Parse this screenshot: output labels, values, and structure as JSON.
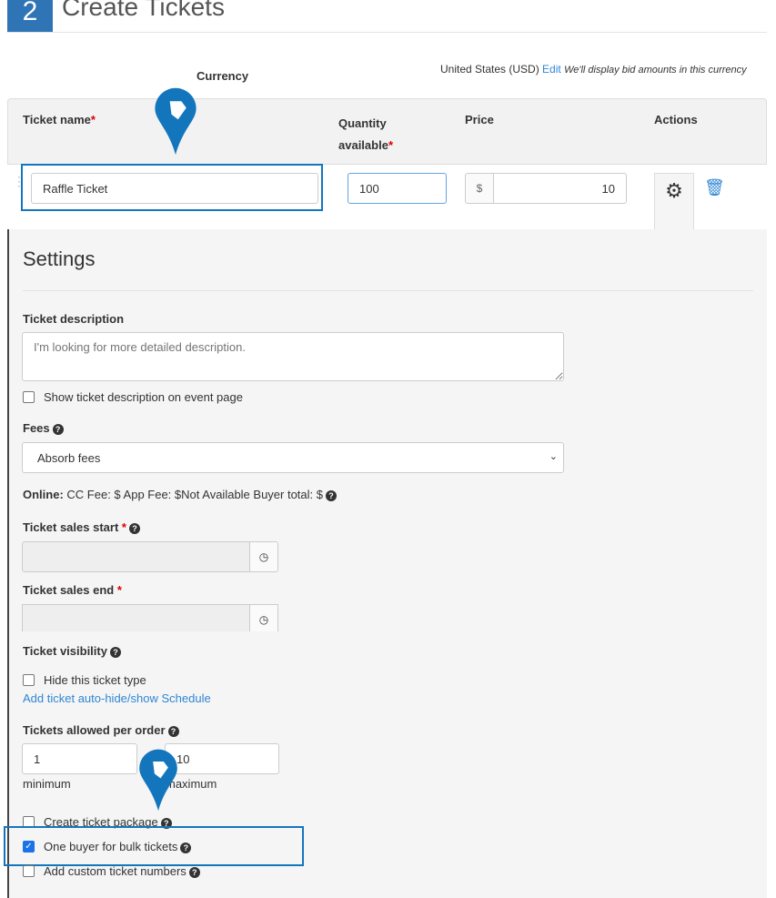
{
  "header": {
    "step": "2",
    "title": "Create Tickets"
  },
  "currency": {
    "label": "Currency",
    "value": "United States (USD)",
    "edit": "Edit",
    "note": "We'll display bid amounts in this currency"
  },
  "table": {
    "columns": {
      "name": "Ticket name",
      "quantity": "Quantity available",
      "price": "Price",
      "actions": "Actions"
    },
    "required_mark": "*",
    "row": {
      "name": "Raffle Ticket",
      "quantity": "100",
      "currency_symbol": "$",
      "price": "10"
    }
  },
  "settings": {
    "title": "Settings",
    "description_label": "Ticket description",
    "description_placeholder": "I'm looking for more detailed description.",
    "show_description": "Show ticket description on event page",
    "fees_label": "Fees",
    "fees_value": "Absorb fees",
    "online_label": "Online:",
    "online_text": "CC Fee: $ App Fee: $Not Available Buyer total: $",
    "sales_start": "Ticket sales start",
    "sales_end": "Ticket sales end",
    "visibility_label": "Ticket visibility",
    "hide_ticket": "Hide this ticket type",
    "auto_hide_link": "Add ticket auto-hide/show Schedule",
    "per_order_label": "Tickets allowed per order",
    "min_value": "1",
    "min_label": "minimum",
    "max_value": "10",
    "max_label": "maximum",
    "package": "Create ticket package",
    "bulk": "One buyer for bulk tickets",
    "bulk_checked": true,
    "custom_numbers": "Add custom ticket numbers"
  },
  "colors": {
    "accent": "#2f74b5",
    "highlight": "#1376bd"
  }
}
